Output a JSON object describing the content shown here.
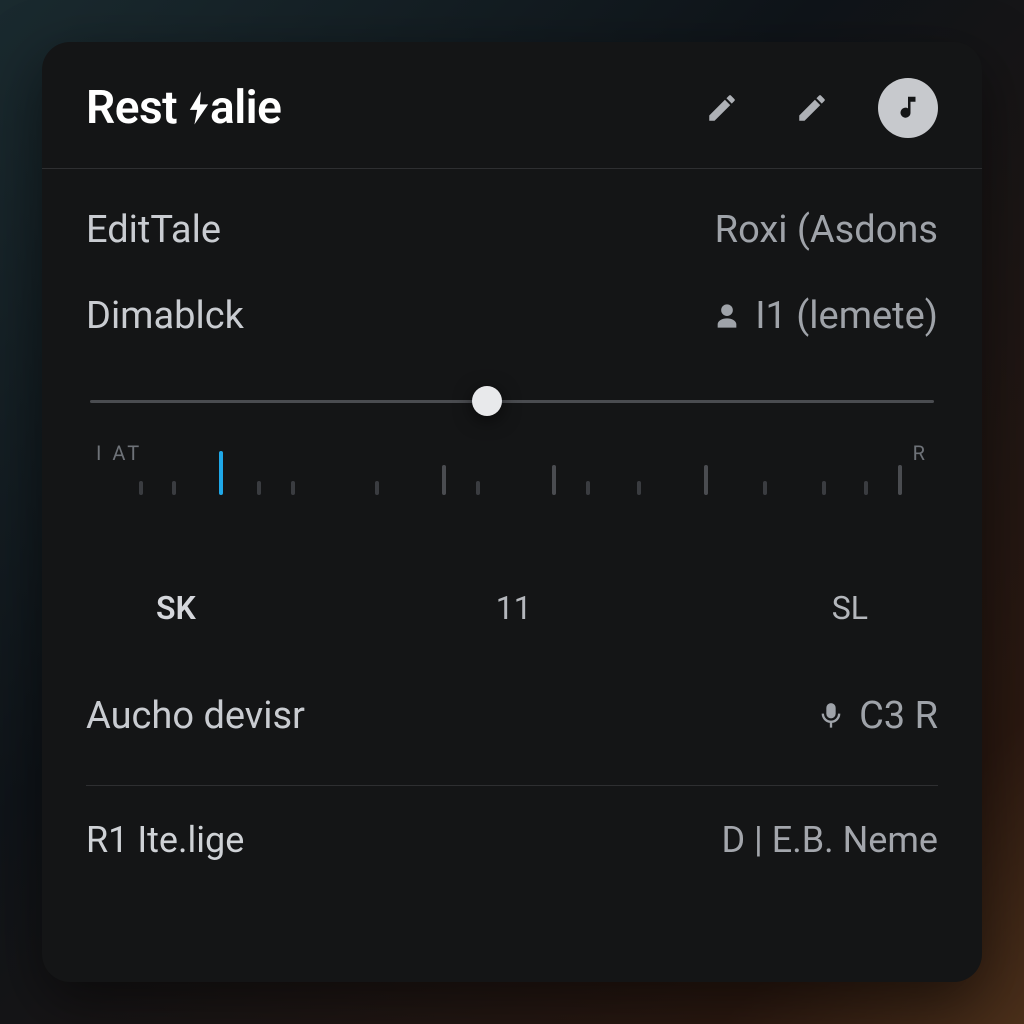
{
  "header": {
    "title_a": "Rest ",
    "title_b": "alie"
  },
  "rows": {
    "edit": {
      "label": "EditTale",
      "value": "Roxi (Asdons"
    },
    "dim": {
      "label": "Dimablck",
      "value": "I1 (lemete)"
    },
    "audio": {
      "label": "Aucho devisr",
      "value": "C3 R"
    },
    "footer": {
      "label": "R1 Ite.lige",
      "value": "D | E.B. Neme"
    }
  },
  "slider": {
    "percent": 47
  },
  "ruler": {
    "left_tag": "I AT",
    "right_tag": "R",
    "labels": [
      "SK",
      "11",
      "SL"
    ],
    "ticks": [
      {
        "pos": 6,
        "cls": "minor"
      },
      {
        "pos": 10,
        "cls": "minor"
      },
      {
        "pos": 15.5,
        "cls": "hi"
      },
      {
        "pos": 20,
        "cls": "minor"
      },
      {
        "pos": 24,
        "cls": "minor"
      },
      {
        "pos": 34,
        "cls": "minor"
      },
      {
        "pos": 42,
        "cls": "major"
      },
      {
        "pos": 46,
        "cls": "minor"
      },
      {
        "pos": 55,
        "cls": "major"
      },
      {
        "pos": 59,
        "cls": "minor"
      },
      {
        "pos": 65,
        "cls": "minor"
      },
      {
        "pos": 73,
        "cls": "major"
      },
      {
        "pos": 80,
        "cls": "minor"
      },
      {
        "pos": 87,
        "cls": "minor"
      },
      {
        "pos": 92,
        "cls": "minor"
      },
      {
        "pos": 96,
        "cls": "major"
      }
    ]
  }
}
